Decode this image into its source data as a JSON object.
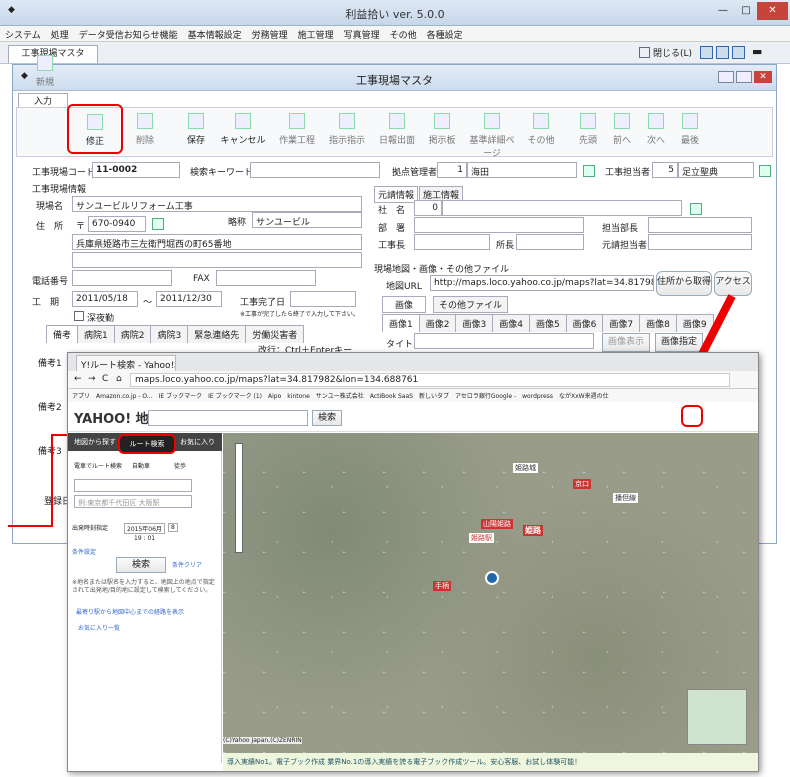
{
  "app": {
    "title": "利益拾い ver. 5.0.0",
    "close_label": "閉じる(L)"
  },
  "menu": [
    "システム",
    "処理",
    "データ受信お知らせ機能",
    "基本情報設定",
    "労務管理",
    "施工管理",
    "写真管理",
    "その他",
    "各種設定"
  ],
  "tab": {
    "label": "工事現場マスタ"
  },
  "window": {
    "title": "工事現場マスタ"
  },
  "mode_tab": "入力",
  "toolbar": {
    "new": "新規",
    "edit": "修正",
    "delete": "削除",
    "save": "保存",
    "cancel": "キャンセル",
    "work_daily": "作業工程",
    "work_instr": "指示指示",
    "daily_out": "日報出面",
    "show_board": "掲示板",
    "standard": "基準詳細ページ",
    "other": "その他",
    "first": "先頭",
    "prev": "前へ",
    "next": "次へ",
    "last": "最後"
  },
  "form": {
    "site_code_label": "工事現場コード",
    "site_code": "11-0002",
    "search_keyword_label": "検索キーワード",
    "base_manager_label": "拠点管理者",
    "base_manager_no": "1",
    "base_manager_name": "海田",
    "site_manager_label": "工事担当者",
    "site_manager_no": "5",
    "site_manager_name": "足立聖典",
    "info_section": "工事現場情報",
    "site_name_label": "現場名",
    "site_name": "サンユービルリフォーム工事",
    "address_label": "住　所",
    "zip_mark": "〒",
    "zip": "670-0940",
    "short_label": "略称",
    "short_name": "サンユービル",
    "address": "兵庫県姫路市三左衛門堀西の町65番地",
    "phone_label": "電話番号",
    "fax_label": "FAX",
    "period_label": "工　期",
    "start": "2011/05/18",
    "tilde": "～",
    "end": "2011/12/30",
    "complete_label": "工事完了日",
    "complete_note": "※工事が完了したら終了で入力して下さい。",
    "night_label": "深夜勤",
    "tabs": [
      "備考",
      "病院1",
      "病院2",
      "病院3",
      "緊急連絡先",
      "労働災害者"
    ],
    "newline_hint": "改行：Ctrl＋Enterキー",
    "biko1": "備考1",
    "biko2": "備考2",
    "biko3": "備考3",
    "register": "登録日",
    "order_section": "元請情報",
    "construct_section": "施工情報",
    "company_label": "社　名",
    "company_no": "0",
    "dept_label": "部　署",
    "dept_head_label": "担当部長",
    "site_chief_label": "工事長",
    "office_chief_label": "所長",
    "contractor_label": "元請担当者",
    "map_section": "現場地図・画像・その他ファイル",
    "map_url_label": "地図URL",
    "map_url": "http://maps.loco.yahoo.co.jp/maps?lat=34.8179828l",
    "get_from_address": "住所から取得",
    "access": "アクセス",
    "img_tab": "画像",
    "other_file_tab": "その他ファイル",
    "img_tabs": [
      "画像1",
      "画像2",
      "画像3",
      "画像4",
      "画像5",
      "画像6",
      "画像7",
      "画像8",
      "画像9"
    ],
    "title_label": "タイトル",
    "img_show": "画像表示",
    "img_set": "画像指定"
  },
  "browser": {
    "tab_title": "Y!ルート検索 - Yahoo!地図",
    "url": "maps.loco.yahoo.co.jp/maps?lat=34.817982&lon=134.688761",
    "bookmarks": [
      "アプリ",
      "Amazon.co.jp - O...",
      "IE ブックマーク",
      "IE ブックマーク (1)",
      "Aipo",
      "kintone",
      "サンユー株式会社",
      "ActiBook SaaS",
      "新しいタブ",
      "アセロラ銀行Google -",
      "wordpress",
      "ながXxW来週の仕"
    ],
    "logo": "YAHOO! 地図",
    "search_btn": "検索",
    "side_tabs": [
      "地図から探す",
      "ルート検索",
      "お気に入り"
    ],
    "modes": [
      "電車でルート検索",
      "自動車",
      "徒歩"
    ],
    "dest_placeholder": "例:東京都千代田区 大阪駅",
    "depart": "出発時刻指定",
    "date": "2015年06月",
    "day": "8",
    "hm": "19 : 01",
    "search": "検索",
    "detail": "条件設定",
    "clear": "条件クリア",
    "note": "※地名または駅名を入力すると、地図上の地点で指定されて出発地/目的地に設定して検索してください。",
    "nearest": "最寄り駅から地図中心までの経路を表示",
    "fav": "お気に入り一覧",
    "map_labels": [
      "姫路",
      "山陽姫路",
      "姫路駅",
      "手柄",
      "姫路城",
      "京口",
      "播但線"
    ],
    "footer": "導入実績No1。電子ブック作成 業界No.1の導入実績を誇る電子ブック作成ツール。安心客服、お試し体験可能！",
    "copyright": "(C)Yahoo Japan,(C)ZENRIN"
  }
}
